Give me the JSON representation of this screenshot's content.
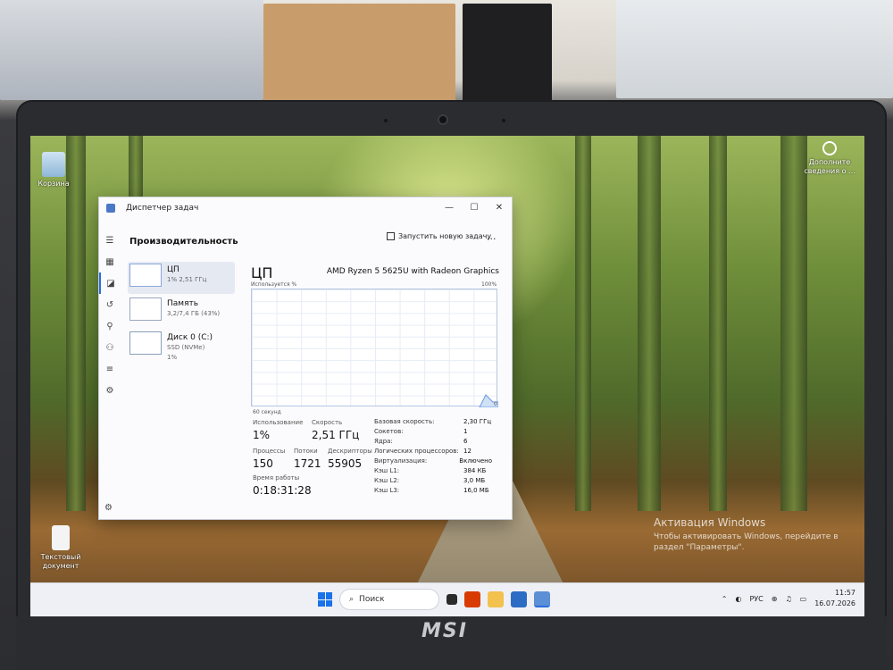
{
  "colors": {
    "accent": "#2a6fdb",
    "graph_line": "#6b9be0",
    "graph_fill": "#cfe0f7"
  },
  "desktop": {
    "icons": [
      {
        "label": "Корзина",
        "icon": "recycle-bin-icon"
      },
      {
        "label": "Текстовый документ",
        "icon": "text-document-icon"
      }
    ],
    "notification": "Дополните сведения о ...",
    "activation": {
      "title": "Активация Windows",
      "text": "Чтобы активировать Windows, перейдите в раздел \"Параметры\"."
    }
  },
  "taskbar": {
    "search_placeholder": "Поиск",
    "lang": "РУС",
    "time": "11:57",
    "date": "16.07.2026"
  },
  "task_manager": {
    "window_title": "Диспетчер задач",
    "page_title": "Производительность",
    "new_task": "Запустить новую задачу",
    "more": "...",
    "sidebar": [
      {
        "name": "ЦП",
        "sub": "1% 2,51 ГГц"
      },
      {
        "name": "Память",
        "sub": "3,2/7,4 ГБ (43%)"
      },
      {
        "name": "Диск 0 (C:)",
        "sub": "SSD (NVMe)",
        "sub2": "1%"
      }
    ],
    "main": {
      "title": "ЦП",
      "cpu_model": "AMD Ryzen 5 5625U with Radeon Graphics",
      "graph_top_left": "Используется %",
      "graph_top_right": "100%",
      "graph_bottom_left": "60 секунд",
      "graph_bottom_right": "0"
    },
    "stats": {
      "usage_label": "Использование",
      "usage": "1%",
      "speed_label": "Скорость",
      "speed": "2,51 ГГц",
      "processes_label": "Процессы",
      "processes": "150",
      "threads_label": "Потоки",
      "threads": "1721",
      "handles_label": "Дескрипторы",
      "handles": "55905",
      "uptime_label": "Время работы",
      "uptime": "0:18:31:28"
    },
    "specs": [
      {
        "k": "Базовая скорость:",
        "v": "2,30 ГГц"
      },
      {
        "k": "Сокетов:",
        "v": "1"
      },
      {
        "k": "Ядра:",
        "v": "6"
      },
      {
        "k": "Логических процессоров:",
        "v": "12"
      },
      {
        "k": "Виртуализация:",
        "v": "Включено"
      },
      {
        "k": "Кэш L1:",
        "v": "384 КБ"
      },
      {
        "k": "Кэш L2:",
        "v": "3,0 МБ"
      },
      {
        "k": "Кэш L3:",
        "v": "16,0 МБ"
      }
    ]
  },
  "laptop_brand": "MSI"
}
